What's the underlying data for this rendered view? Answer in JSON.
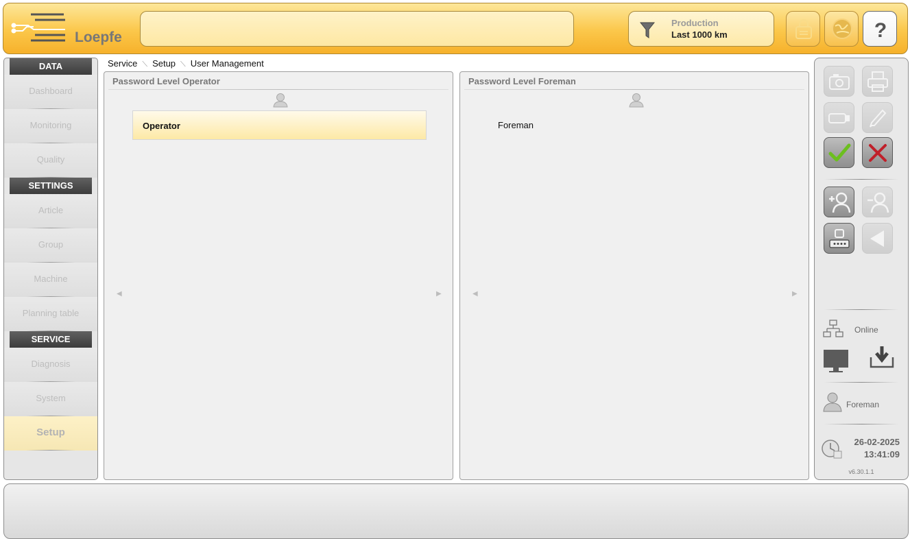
{
  "app": {
    "logo_text": "Loepfe"
  },
  "header": {
    "title_value": "",
    "production_label": "Production",
    "production_range": "Last 1000 km"
  },
  "nav": {
    "sections": [
      {
        "title": "DATA",
        "items": [
          "Dashboard",
          "Monitoring",
          "Quality"
        ]
      },
      {
        "title": "SETTINGS",
        "items": [
          "Article",
          "Group",
          "Machine",
          "Planning table"
        ]
      },
      {
        "title": "SERVICE",
        "items": [
          "Diagnosis",
          "System",
          "Setup"
        ]
      }
    ],
    "active_item": "Setup"
  },
  "breadcrumb": [
    "Service",
    "Setup",
    "User Management"
  ],
  "panels": [
    {
      "title": "Password Level Operator",
      "users": [
        "Operator"
      ],
      "selected": "Operator"
    },
    {
      "title": "Password Level Foreman",
      "users": [
        "Foreman"
      ],
      "selected": ""
    }
  ],
  "toolbar": {
    "connection_status": "Online",
    "current_user": "Foreman",
    "date": "26-02-2025",
    "time": "13:41:09",
    "version": "v6.30.1.1"
  },
  "icons": {
    "header": [
      "filter-icon",
      "lock-icon",
      "globe-icon",
      "help-icon"
    ],
    "toolbar": [
      "camera-icon",
      "print-icon",
      "usb-icon",
      "edit-icon",
      "confirm-icon",
      "cancel-icon",
      "add-user-icon",
      "remove-user-icon",
      "password-icon",
      "back-icon",
      "network-icon",
      "monitor-icon",
      "download-icon",
      "user-icon",
      "clock-icon"
    ]
  },
  "colors": {
    "accent": "#f6b12b",
    "confirm": "#6cbf1f",
    "cancel": "#c0202a"
  }
}
